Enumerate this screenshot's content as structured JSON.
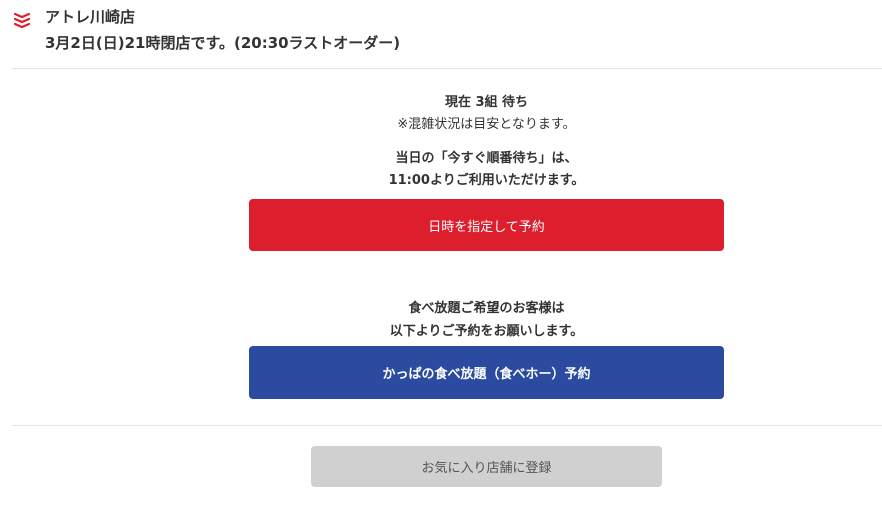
{
  "header": {
    "brand_icon": "kappa-sushi-logo-icon",
    "brand_color": "#dc1e2d",
    "store_name": "アトレ川崎店",
    "closing_notice": "3月2日(日)21時閉店です。(20:30ラストオーダー)"
  },
  "waiting": {
    "count_text": "現在 3組 待ち",
    "note": "※混雑状況は目安となります。"
  },
  "same_day": {
    "line1": "当日の「今すぐ順番待ち」は、",
    "line2": "11:00よりご利用いただけます。"
  },
  "reserve_button": {
    "label": "日時を指定して予約",
    "color": "#dc1e2d"
  },
  "buffet": {
    "line1": "食べ放題ご希望のお客様は",
    "line2": "以下よりご予約をお願いします。",
    "button_label": "かっぱの食べ放題（食べホー）予約",
    "button_color": "#2b4ba0"
  },
  "favorite_button": {
    "label": "お気に入り店舗に登録"
  }
}
